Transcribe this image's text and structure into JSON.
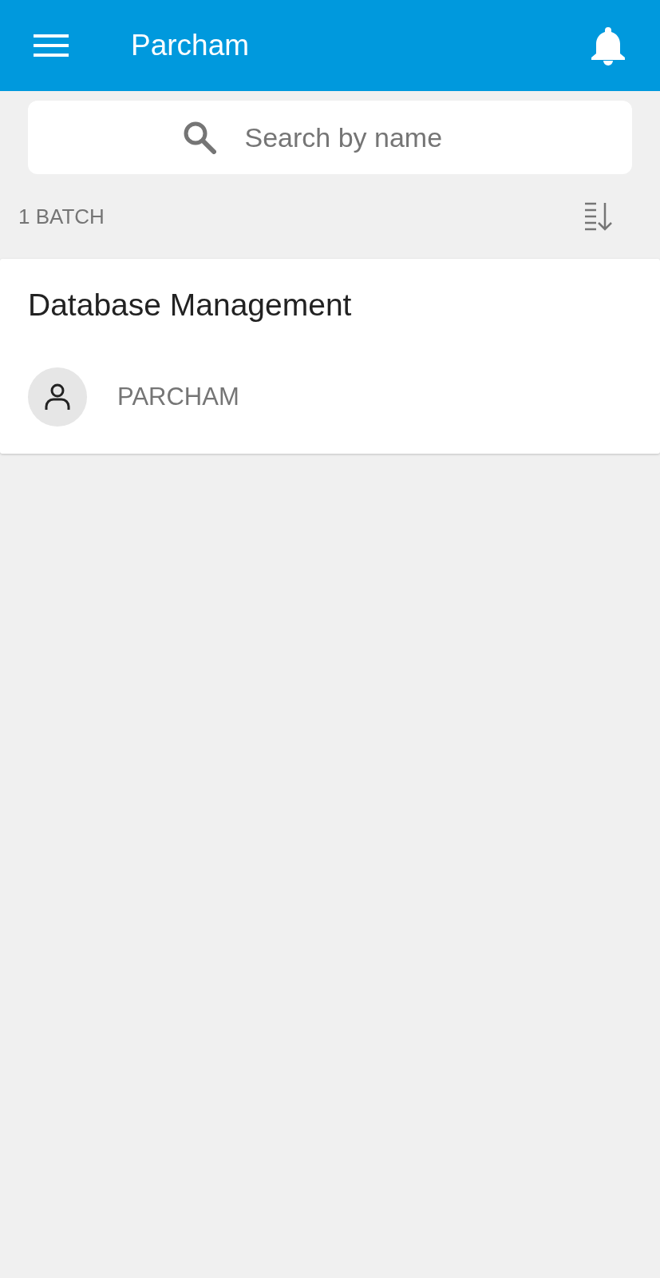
{
  "app_bar": {
    "title": "Parcham"
  },
  "search": {
    "placeholder": "Search by name"
  },
  "list_header": {
    "count": "1 BATCH"
  },
  "batches": [
    {
      "name": "Database Management",
      "owner": "PARCHAM"
    }
  ]
}
